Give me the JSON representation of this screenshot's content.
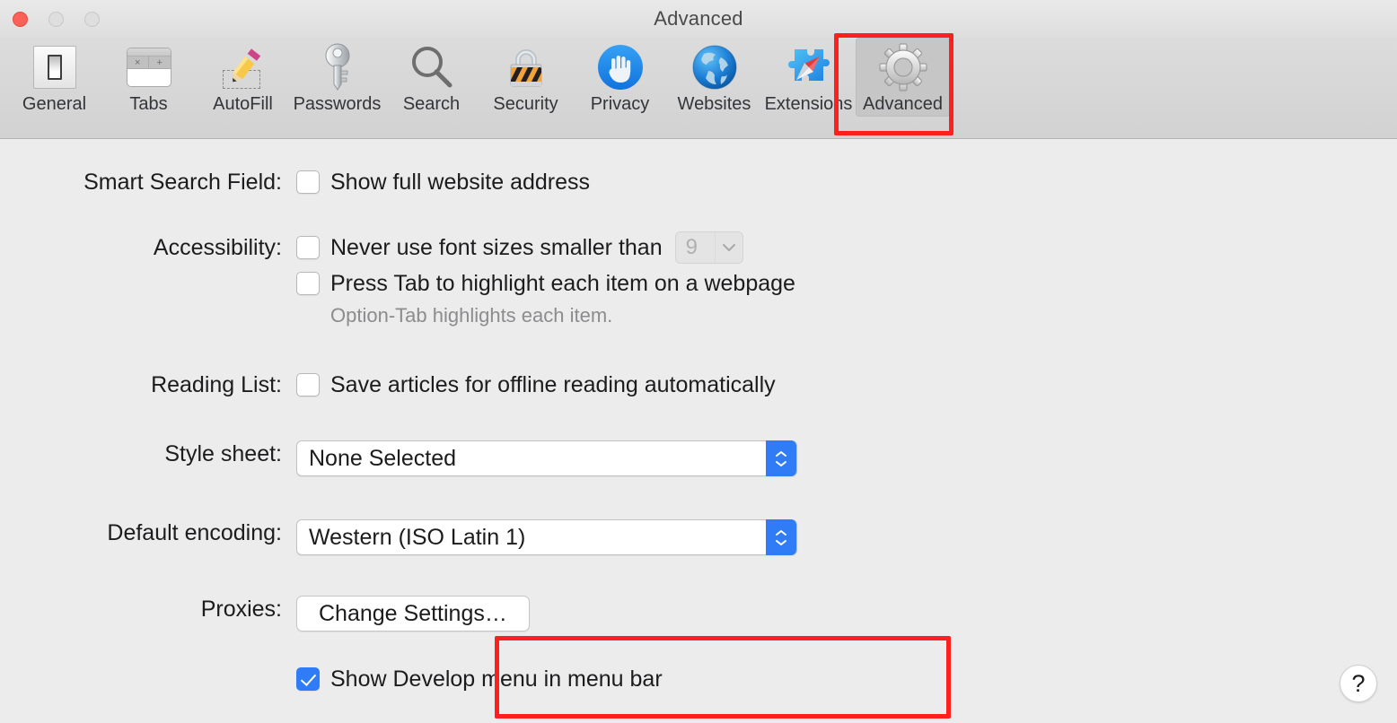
{
  "window": {
    "title": "Advanced",
    "traffic_lights": [
      {
        "name": "close",
        "color": "#fc6158"
      },
      {
        "name": "minimize",
        "color": "#dedede"
      },
      {
        "name": "zoom",
        "color": "#dedede"
      }
    ]
  },
  "toolbar": {
    "tabs": [
      {
        "label": "General",
        "icon": "general-icon",
        "selected": false
      },
      {
        "label": "Tabs",
        "icon": "tabs-icon",
        "selected": false
      },
      {
        "label": "AutoFill",
        "icon": "autofill-icon",
        "selected": false
      },
      {
        "label": "Passwords",
        "icon": "passwords-icon",
        "selected": false
      },
      {
        "label": "Search",
        "icon": "search-icon",
        "selected": false
      },
      {
        "label": "Security",
        "icon": "security-icon",
        "selected": false
      },
      {
        "label": "Privacy",
        "icon": "privacy-icon",
        "selected": false
      },
      {
        "label": "Websites",
        "icon": "websites-icon",
        "selected": false
      },
      {
        "label": "Extensions",
        "icon": "extensions-icon",
        "selected": false
      },
      {
        "label": "Advanced",
        "icon": "advanced-icon",
        "selected": true
      }
    ],
    "tabs_icon_glyphs": {
      "close": "×",
      "add": "+"
    }
  },
  "annotations": {
    "color": "#ff1f1f",
    "boxes": [
      {
        "name": "advanced-tab-highlight"
      },
      {
        "name": "show-develop-menu-highlight"
      }
    ]
  },
  "settings": {
    "smart_search_field": {
      "label": "Smart Search Field:",
      "show_full_address": {
        "text": "Show full website address",
        "checked": false
      }
    },
    "accessibility": {
      "label": "Accessibility:",
      "never_use_font_sizes": {
        "text": "Never use font sizes smaller than",
        "checked": false
      },
      "font_size_value": "9",
      "press_tab": {
        "text": "Press Tab to highlight each item on a webpage",
        "checked": false
      },
      "hint": "Option-Tab highlights each item."
    },
    "reading_list": {
      "label": "Reading List:",
      "save_offline": {
        "text": "Save articles for offline reading automatically",
        "checked": false
      }
    },
    "style_sheet": {
      "label": "Style sheet:",
      "value": "None Selected"
    },
    "default_encoding": {
      "label": "Default encoding:",
      "value": "Western (ISO Latin 1)"
    },
    "proxies": {
      "label": "Proxies:",
      "button": "Change Settings…"
    },
    "develop_menu": {
      "text": "Show Develop menu in menu bar",
      "checked": true
    }
  },
  "help": {
    "glyph": "?"
  },
  "colors": {
    "accent_blue": "#2f7cf6",
    "annotation_red": "#ff1f1f",
    "toolbar_bg": "#d6d6d6",
    "content_bg": "#ececec"
  }
}
